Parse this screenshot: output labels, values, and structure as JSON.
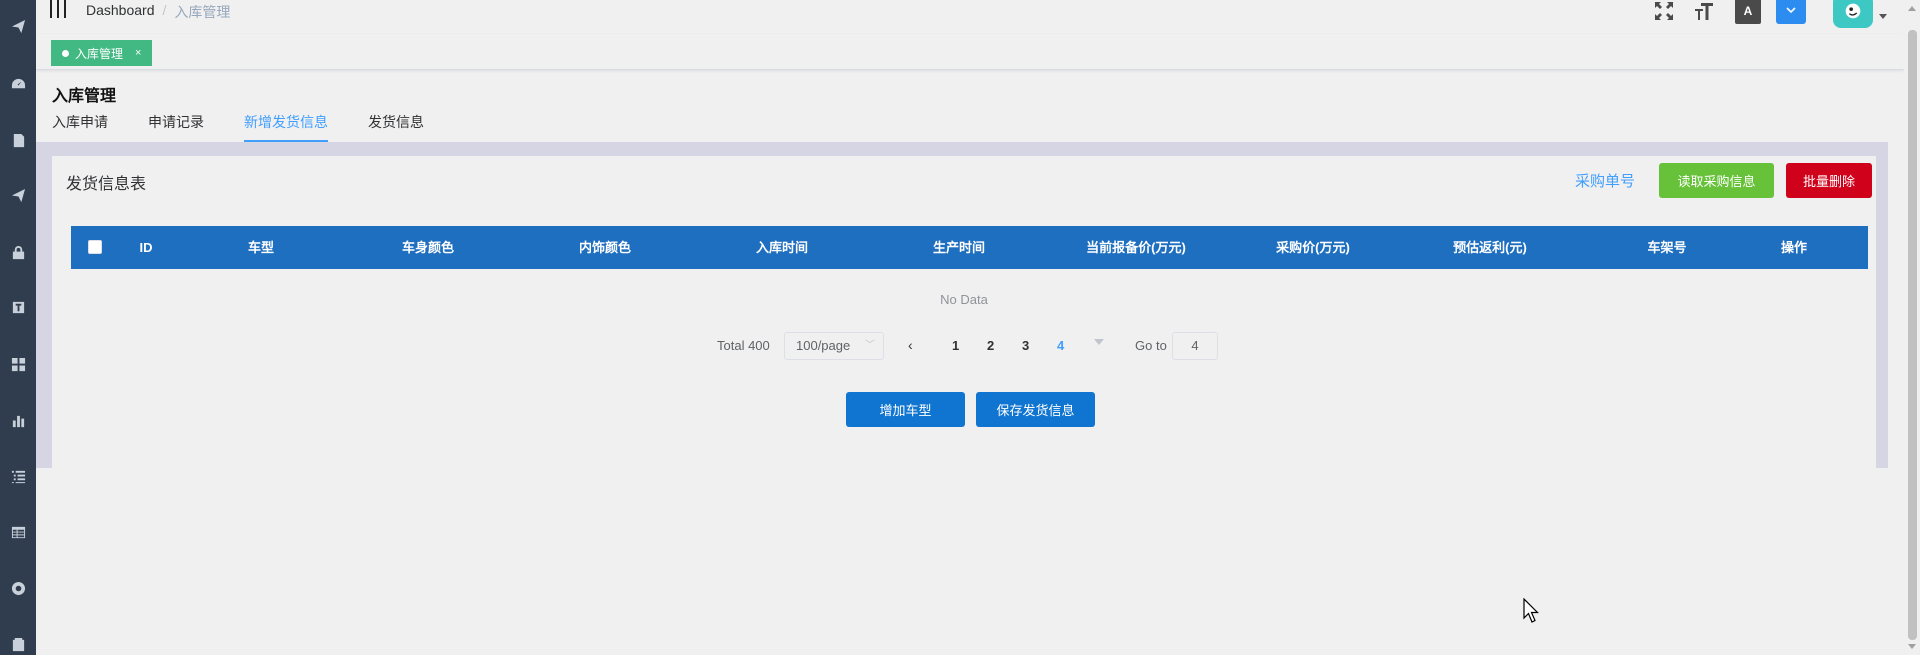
{
  "breadcrumb": {
    "home": "Dashboard",
    "separator": "/",
    "current": "入库管理"
  },
  "tags_view": {
    "active_tag": "入库管理",
    "close": "×"
  },
  "page": {
    "title": "入库管理"
  },
  "tabs": [
    {
      "label": "入库申请"
    },
    {
      "label": "申请记录"
    },
    {
      "label": "新增发货信息",
      "active": true
    },
    {
      "label": "发货信息"
    }
  ],
  "toolbar": {
    "lang_label": "A"
  },
  "panel": {
    "title": "发货信息表",
    "link_label": "采购单号",
    "read_button": "读取采购信息",
    "delete_button": "批量删除"
  },
  "table": {
    "columns": [
      "ID",
      "车型",
      "车身颜色",
      "内饰颜色",
      "入库时间",
      "生产时间",
      "当前报备价(万元)",
      "采购价(万元)",
      "预估返利(元)",
      "车架号",
      "操作"
    ],
    "empty_text": "No Data"
  },
  "pagination": {
    "total_text": "Total 400",
    "page_size": "100/page",
    "pages": [
      "1",
      "2",
      "3",
      "4"
    ],
    "current_page": "4",
    "goto_label": "Go to",
    "goto_value": "4"
  },
  "actions": {
    "add_model": "增加车型",
    "save_shipping": "保存发货信息"
  },
  "colors": {
    "sidebar": "#2f3d4f",
    "table_header": "#1f6fc0",
    "accent": "#409eff",
    "success": "#67c23a",
    "danger": "#d0021b",
    "primary_button": "#1075d1",
    "tag": "#42b983"
  },
  "icons": {
    "sidebar": [
      "send-icon",
      "dashboard-icon",
      "document-icon",
      "send-icon",
      "lock-icon",
      "text-icon",
      "grid-icon",
      "chart-icon",
      "list-icon",
      "table-icon",
      "target-icon",
      "clipboard-icon"
    ],
    "toolbar": [
      "hamburger-icon",
      "fullscreen-icon",
      "font-size-icon",
      "language-icon",
      "dropdown-icon",
      "avatar-icon"
    ]
  }
}
